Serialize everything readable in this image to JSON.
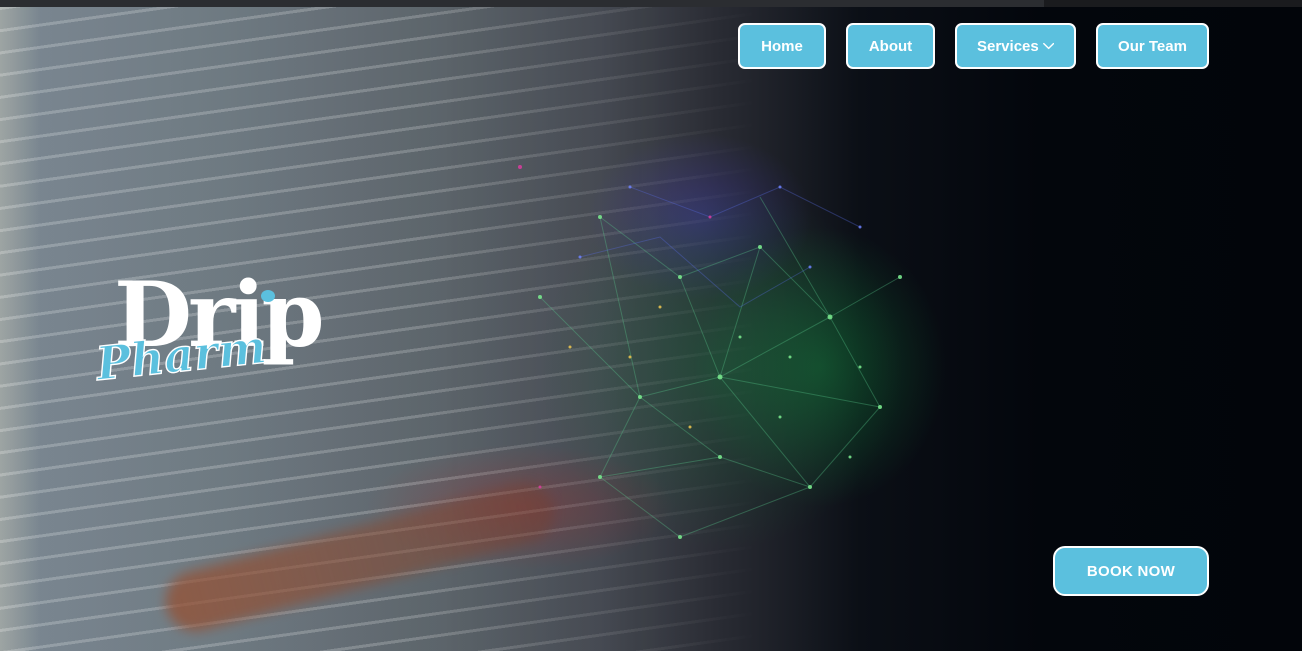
{
  "nav": {
    "items": [
      {
        "label": "Home"
      },
      {
        "label": "About"
      },
      {
        "label": "Services"
      },
      {
        "label": "Our Team"
      }
    ]
  },
  "logo": {
    "line1": "Drip",
    "line2": "Pharm"
  },
  "hero": {
    "cta_label": "BOOK NOW"
  },
  "colors": {
    "accent": "#5bc0de",
    "button_border": "#ffffff",
    "background": "#02050a"
  },
  "icons": {
    "services_dropdown": "chevron-down-icon"
  }
}
